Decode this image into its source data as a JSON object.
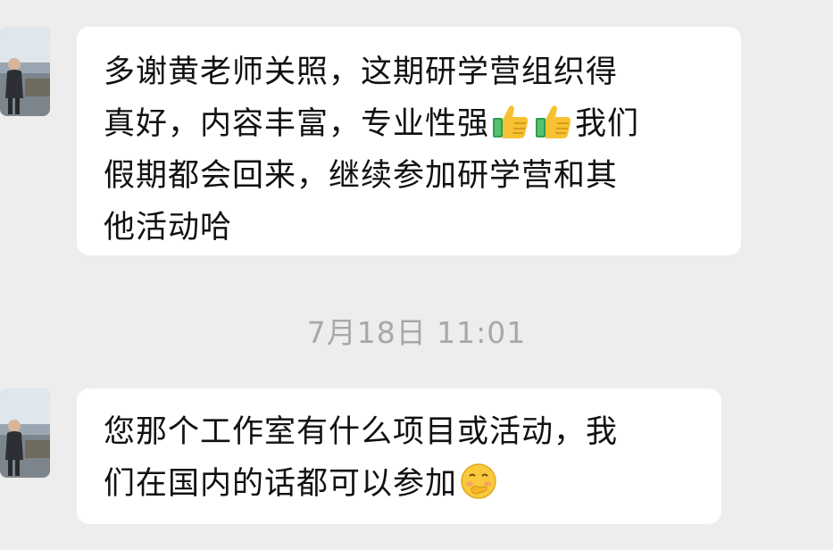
{
  "conversation": {
    "messages": [
      {
        "lines": [
          "多谢黄老师关照，这期研学营组织得",
          "真好，内容丰富，专业性强",
          "我们",
          "假期都会回来，继续参加研学营和其",
          "他活动哈"
        ],
        "emojis": [
          "thumbs-up-icon",
          "thumbs-up-icon"
        ]
      },
      {
        "lines": [
          "您那个工作室有什么项目或活动，我",
          "们在国内的话都可以参加"
        ],
        "emojis": [
          "shy-face-icon"
        ]
      }
    ],
    "timestamp": "7月18日 11:01"
  }
}
